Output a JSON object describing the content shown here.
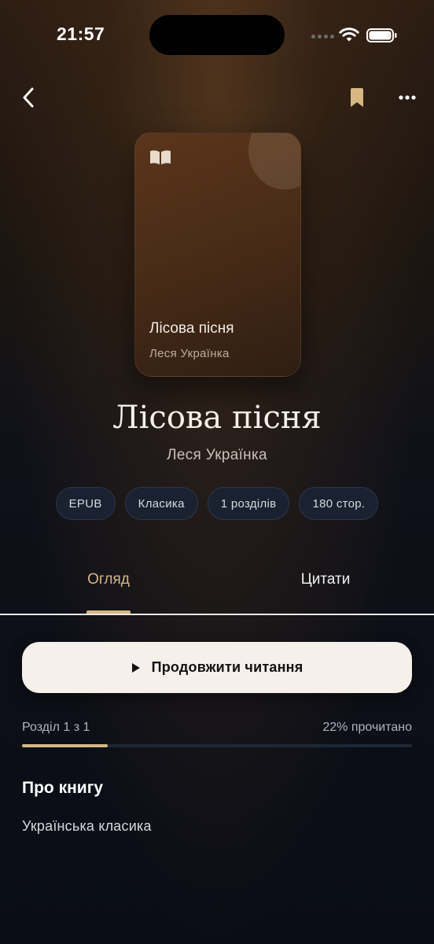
{
  "status_bar": {
    "time": "21:57"
  },
  "cover": {
    "title": "Лісова пісня",
    "author": "Леся Українка"
  },
  "book": {
    "title": "Лісова пісня",
    "author": "Леся Українка"
  },
  "chips": [
    "EPUB",
    "Класика",
    "1 розділів",
    "180 стор."
  ],
  "tabs": {
    "overview": "Огляд",
    "quotes": "Цитати"
  },
  "continue_button": {
    "label": "Продовжити читання"
  },
  "progress": {
    "chapter": "Розділ 1 з 1",
    "percent_label": "22% прочитано",
    "fraction": 0.22
  },
  "about": {
    "heading": "Про книгу",
    "text": "Українська класика"
  },
  "colors": {
    "accent": "#d8b784",
    "background": "#0a0d16",
    "button": "#f5f0ea"
  },
  "icons": [
    "back-chevron-icon",
    "bookmark-icon",
    "more-dots-icon",
    "book-open-icon",
    "play-icon",
    "wifi-icon",
    "battery-icon",
    "signal-icon"
  ]
}
